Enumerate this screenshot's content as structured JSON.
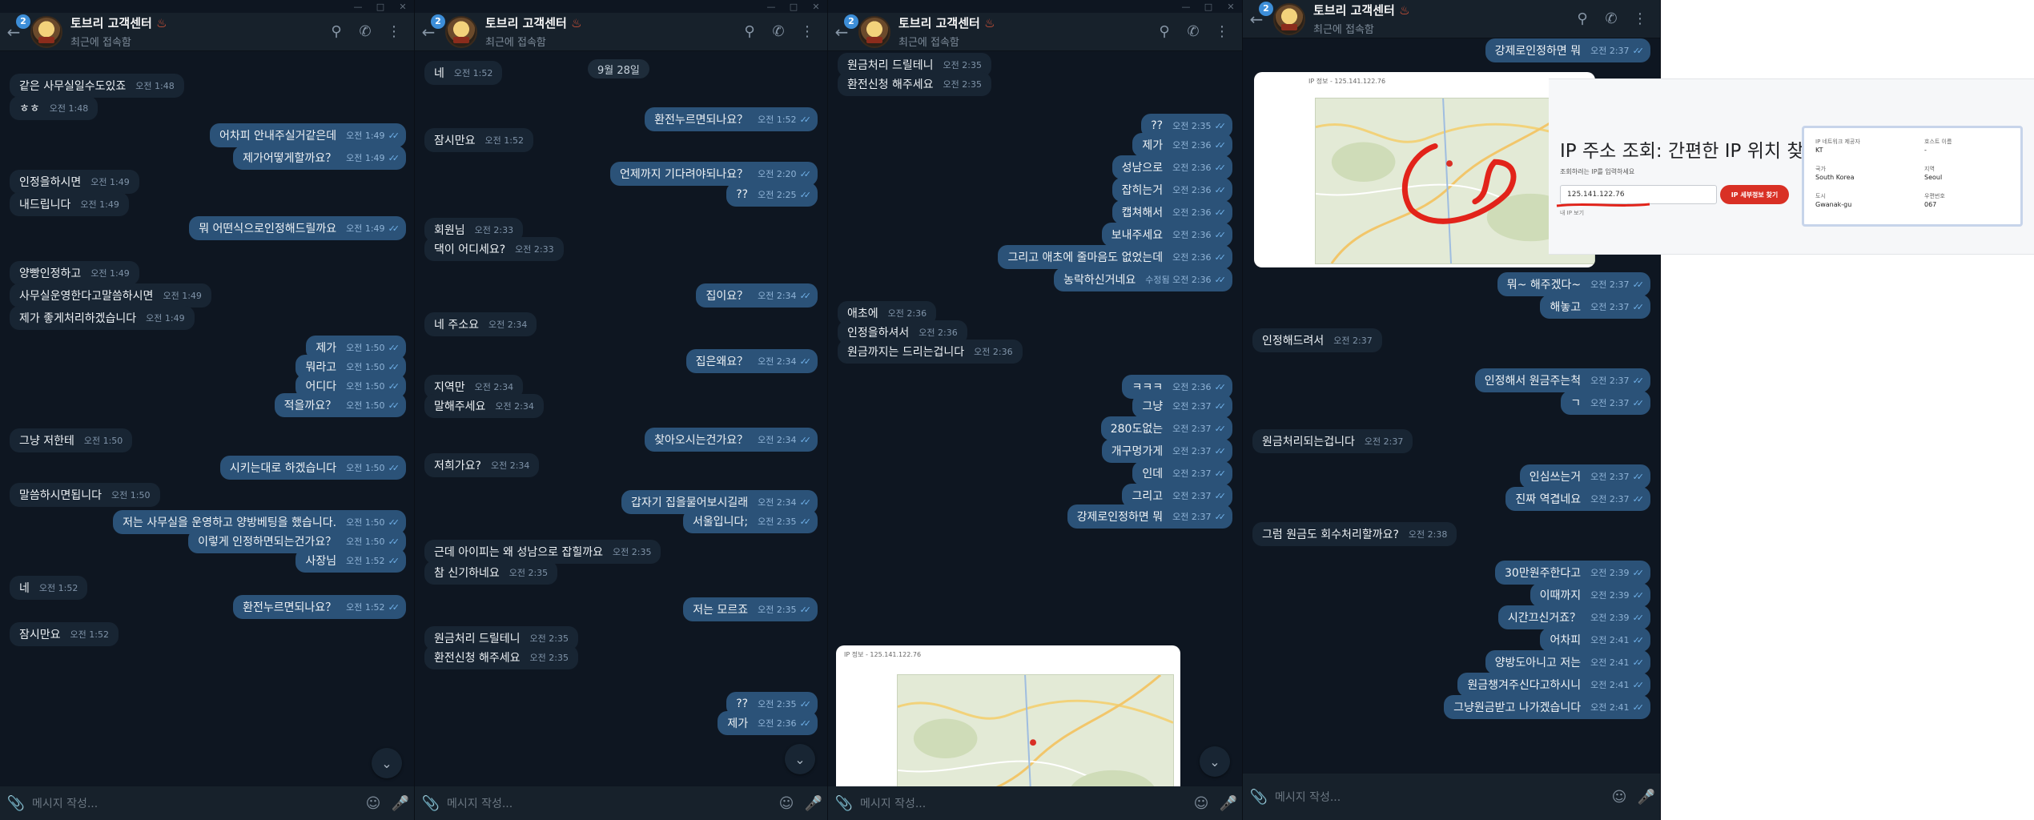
{
  "chat": {
    "title": "토브리 고객센터",
    "subtitle": "최근에 접속함",
    "unread_badge": "2",
    "input_placeholder": "메시지 작성...",
    "accent_color": "#2b5278"
  },
  "panel1": {
    "messages": [
      {
        "text": "같은 사무실일수도있죠",
        "time": "오전 1:48",
        "side": "in"
      },
      {
        "text": "ㅎㅎ",
        "time": "오전 1:48",
        "side": "in"
      },
      {
        "text": "어차피 안내주실거같은데",
        "time": "오전 1:49",
        "side": "out"
      },
      {
        "text": "제가어떻게할까요？",
        "time": "오전 1:49",
        "side": "out"
      },
      {
        "text": "인정을하시면",
        "time": "오전 1:49",
        "side": "in"
      },
      {
        "text": "내드립니다",
        "time": "오전 1:49",
        "side": "in"
      },
      {
        "text": "뭐 어떤식으로인정해드릴까요",
        "time": "오전 1:49",
        "side": "out"
      },
      {
        "text": "양빵인정하고",
        "time": "오전 1:49",
        "side": "in"
      },
      {
        "text": "사무실운영한다고말씀하시면",
        "time": "오전 1:49",
        "side": "in"
      },
      {
        "text": "제가 좋게처리하겠습니다",
        "time": "오전 1:49",
        "side": "in"
      },
      {
        "text": "제가",
        "time": "오전 1:50",
        "side": "out"
      },
      {
        "text": "뭐라고",
        "time": "오전 1:50",
        "side": "out"
      },
      {
        "text": "어디다",
        "time": "오전 1:50",
        "side": "out"
      },
      {
        "text": "적을까요？",
        "time": "오전 1:50",
        "side": "out"
      },
      {
        "text": "그냥 저한테",
        "time": "오전 1:50",
        "side": "in"
      },
      {
        "text": "시키는대로 하겠습니다",
        "time": "오전 1:50",
        "side": "out"
      },
      {
        "text": "말씀하시면됩니다",
        "time": "오전 1:50",
        "side": "in"
      },
      {
        "text": "저는 사무실을 운영하고 양방베팅을 했습니다.",
        "time": "오전 1:50",
        "side": "out"
      },
      {
        "text": "이렇게 인정하면되는건가요？",
        "time": "오전 1:50",
        "side": "out"
      },
      {
        "text": "사장님",
        "time": "오전 1:52",
        "side": "out"
      },
      {
        "text": "네",
        "time": "오전 1:52",
        "side": "in"
      },
      {
        "text": "환전누르면되나요？",
        "time": "오전 1:52",
        "side": "out"
      },
      {
        "text": "잠시만요",
        "time": "오전 1:52",
        "side": "in"
      }
    ]
  },
  "panel2": {
    "date_chip": "9월 28일",
    "messages": [
      {
        "text": "네",
        "time": "오전 1:52",
        "side": "in"
      },
      {
        "text": "환전누르면되나요？",
        "time": "오전 1:52",
        "side": "out"
      },
      {
        "text": "잠시만요",
        "time": "오전 1:52",
        "side": "in"
      },
      {
        "text": "언제까지 기다려야되나요？",
        "time": "오전 2:20",
        "side": "out"
      },
      {
        "text": "??",
        "time": "오전 2:25",
        "side": "out"
      },
      {
        "text": "회원님",
        "time": "오전 2:33",
        "side": "in"
      },
      {
        "text": "댁이 어디세요?",
        "time": "오전 2:33",
        "side": "in"
      },
      {
        "text": "집이요？",
        "time": "오전 2:34",
        "side": "out"
      },
      {
        "text": "네 주소요",
        "time": "오전 2:34",
        "side": "in"
      },
      {
        "text": "집은왜요？",
        "time": "오전 2:34",
        "side": "out"
      },
      {
        "text": "지역만",
        "time": "오전 2:34",
        "side": "in"
      },
      {
        "text": "말해주세요",
        "time": "오전 2:34",
        "side": "in"
      },
      {
        "text": "찾아오시는건가요？",
        "time": "오전 2:34",
        "side": "out"
      },
      {
        "text": "저희가요?",
        "time": "오전 2:34",
        "side": "in"
      },
      {
        "text": "갑자기 집을물어보시길래",
        "time": "오전 2:34",
        "side": "out"
      },
      {
        "text": "서울입니다;",
        "time": "오전 2:35",
        "side": "out"
      },
      {
        "text": "근데 아이피는 왜 성남으로 잡힐까요",
        "time": "오전 2:35",
        "side": "in"
      },
      {
        "text": "참 신기하네요",
        "time": "오전 2:35",
        "side": "in"
      },
      {
        "text": "저는 모르죠",
        "time": "오전 2:35",
        "side": "out"
      },
      {
        "text": "원금처리 드릴테니",
        "time": "오전 2:35",
        "side": "in"
      },
      {
        "text": "환전신청 해주세요",
        "time": "오전 2:35",
        "side": "in"
      },
      {
        "text": "??",
        "time": "오전 2:35",
        "side": "out"
      },
      {
        "text": "제가",
        "time": "오전 2:36",
        "side": "out"
      }
    ]
  },
  "panel3": {
    "messages": [
      {
        "text": "원금처리 드릴테니",
        "time": "오전 2:35",
        "side": "in"
      },
      {
        "text": "환전신청 해주세요",
        "time": "오전 2:35",
        "side": "in"
      },
      {
        "text": "??",
        "time": "오전 2:35",
        "side": "out"
      },
      {
        "text": "제가",
        "time": "오전 2:36",
        "side": "out"
      },
      {
        "text": "성남으로",
        "time": "오전 2:36",
        "side": "out"
      },
      {
        "text": "잡히는거",
        "time": "오전 2:36",
        "side": "out"
      },
      {
        "text": "캡쳐해서",
        "time": "오전 2:36",
        "side": "out"
      },
      {
        "text": "보내주세요",
        "time": "오전 2:36",
        "side": "out"
      },
      {
        "text": "그리고 애초에 줄마음도 없었는데",
        "time": "오전 2:36",
        "side": "out"
      },
      {
        "text": "농락하신거네요",
        "time": "수정됨 오전 2:36",
        "side": "out"
      },
      {
        "text": "애초에",
        "time": "오전 2:36",
        "side": "in"
      },
      {
        "text": "인정을하셔서",
        "time": "오전 2:36",
        "side": "in"
      },
      {
        "text": "원금까지는 드리는겁니다",
        "time": "오전 2:36",
        "side": "in"
      },
      {
        "text": "ㅋㅋㅋ",
        "time": "오전 2:36",
        "side": "out"
      },
      {
        "text": "그냥",
        "time": "오전 2:37",
        "side": "out"
      },
      {
        "text": "280도없는",
        "time": "오전 2:37",
        "side": "out"
      },
      {
        "text": "개구멍가게",
        "time": "오전 2:37",
        "side": "out"
      },
      {
        "text": "인데",
        "time": "오전 2:37",
        "side": "out"
      },
      {
        "text": "그리고",
        "time": "오전 2:37",
        "side": "out"
      },
      {
        "text": "강제로인정하면 뭐",
        "time": "오전 2:37",
        "side": "out"
      }
    ],
    "image_title": "IP 정보 - 125.141.122.76"
  },
  "panel4": {
    "messages": [
      {
        "text": "강제로인정하면 뭐",
        "time": "오전 2:37",
        "side": "out"
      },
      {
        "text": "뭐~ 해주겠다~",
        "time": "오전 2:37",
        "side": "out"
      },
      {
        "text": "해놓고",
        "time": "오전 2:37",
        "side": "out"
      },
      {
        "text": "인정해드려서",
        "time": "오전 2:37",
        "side": "in"
      },
      {
        "text": "인정해서 원금주는척",
        "time": "오전 2:37",
        "side": "out"
      },
      {
        "text": "ㄱ",
        "time": "오전 2:37",
        "side": "out"
      },
      {
        "text": "원금처리되는겁니다",
        "time": "오전 2:37",
        "side": "in"
      },
      {
        "text": "인심쓰는거",
        "time": "오전 2:37",
        "side": "out"
      },
      {
        "text": "진짜 역겹네요",
        "time": "오전 2:37",
        "side": "out"
      },
      {
        "text": "그럼 원금도 회수처리할까요?",
        "time": "오전 2:38",
        "side": "in"
      },
      {
        "text": "30만원주한다고",
        "time": "오전 2:39",
        "side": "out"
      },
      {
        "text": "이때까지",
        "time": "오전 2:39",
        "side": "out"
      },
      {
        "text": "시간끄신거죠？",
        "time": "오전 2:39",
        "side": "out"
      },
      {
        "text": "어차피",
        "time": "오전 2:41",
        "side": "out"
      },
      {
        "text": "양방도아니고 저는",
        "time": "오전 2:41",
        "side": "out"
      },
      {
        "text": "원금챙겨주신다고하시니",
        "time": "오전 2:41",
        "side": "out"
      },
      {
        "text": "그냥원금받고 나가겠습니다",
        "time": "오전 2:41",
        "side": "out"
      }
    ],
    "ip_page": {
      "window_title": "IP 정보 - 125.141.122.76",
      "heading": "IP 주소 조회: 간편한 IP 위치 찾기",
      "label": "조회하려는 IP를 입력하세요",
      "input_value": "125.141.122.76",
      "button": "IP 세부정보 찾기",
      "note": "내 IP 보기",
      "info": [
        {
          "k": "IP 네트워크 제공자",
          "v": "KT"
        },
        {
          "k": "호스트 이름",
          "v": "-"
        },
        {
          "k": "국가",
          "v": "South Korea"
        },
        {
          "k": "지역",
          "v": "Seoul"
        },
        {
          "k": "도시",
          "v": "Gwanak-gu"
        },
        {
          "k": "우편번호",
          "v": "067"
        }
      ]
    }
  }
}
